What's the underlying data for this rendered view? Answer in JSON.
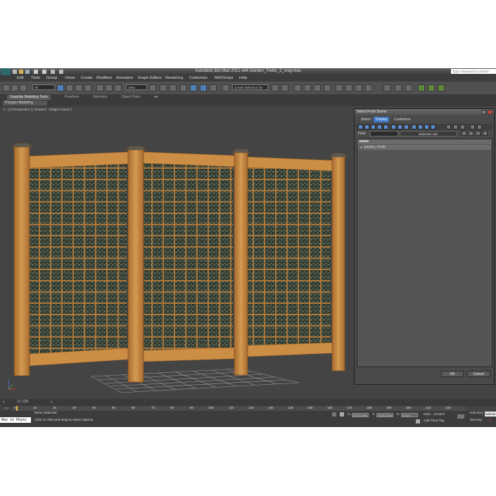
{
  "titlebar": {
    "title": "Autodesk 3ds Max  2012 x64     Garden_Trellis_2_vray.max",
    "search_placeholder": "Type a keyword or phrase"
  },
  "menu": [
    "Edit",
    "Tools",
    "Group",
    "Views",
    "Create",
    "Modifiers",
    "Animation",
    "Graph Editors",
    "Rendering",
    "Customize",
    "MAXScript",
    "Help"
  ],
  "toolbar": {
    "selection_filter": "All",
    "reference_coord": "View",
    "selection_set": "Create Selection Se"
  },
  "ribbon": {
    "tabs": [
      "Graphite Modeling Tools",
      "Freeform",
      "Selection",
      "Object Paint"
    ],
    "active_tab": "Graphite Modeling Tools",
    "panel_label": "Polygon Modeling"
  },
  "viewport": {
    "label": "[ + ] [ Perspective ] [ Shaded + Edged Faces ]"
  },
  "dialog": {
    "title": "Select From Scene",
    "tabs": [
      "Select",
      "Display",
      "Customize"
    ],
    "active_tab": "Display",
    "find_label": "Find:",
    "selection_set_label": "Selection Set:",
    "column_header": "Name",
    "items": [
      "Garden_Trellis"
    ],
    "ok_label": "OK",
    "cancel_label": "Cancel"
  },
  "timeline": {
    "frame_counter": "0 / 225",
    "ticks": [
      "0",
      "10",
      "20",
      "30",
      "40",
      "50",
      "60",
      "70",
      "80",
      "90",
      "100",
      "110",
      "120",
      "130",
      "140",
      "150",
      "160",
      "170",
      "180",
      "190",
      "200",
      "210",
      "220"
    ]
  },
  "status": {
    "maxscript": "Max to Physc",
    "selection_status": "None Selected",
    "prompt": "Click or click-and-drag to select objects",
    "x_label": "X:",
    "x_value": "2578,426m",
    "y_label": "Y:",
    "y_value": "2436,322m",
    "z_label": "Z:",
    "z_value": "0,0cm",
    "grid": "Grid = 10,0cm",
    "add_time_tag": "Add Time Tag",
    "auto_key": "Auto Key",
    "selected_label": "Selecte",
    "set_key": "Set Key"
  },
  "colors": {
    "wood": "#c8893f",
    "wood_dark": "#9c6028",
    "ivy": "#3e4a3c",
    "accent_blue": "#3c78c8",
    "viewport_bg": "#444444"
  }
}
